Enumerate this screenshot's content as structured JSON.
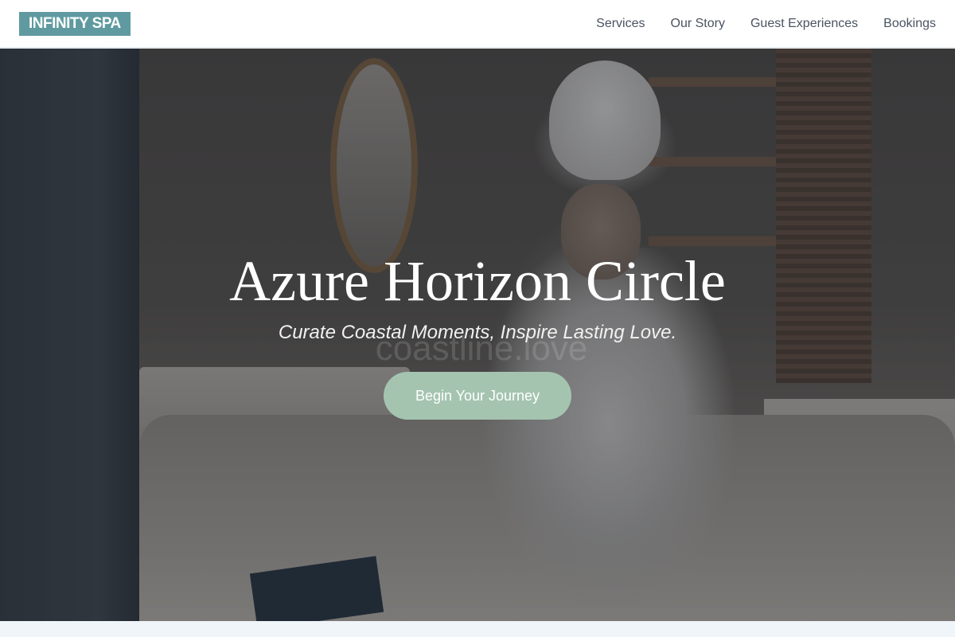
{
  "header": {
    "logo": "INFINITY SPA",
    "nav": [
      {
        "label": "Services"
      },
      {
        "label": "Our Story"
      },
      {
        "label": "Guest Experiences"
      },
      {
        "label": "Bookings"
      }
    ]
  },
  "hero": {
    "title": "Azure Horizon Circle",
    "subtitle": "Curate Coastal Moments, Inspire Lasting Love.",
    "cta_label": "Begin Your Journey",
    "watermark": "coastline.love"
  },
  "colors": {
    "logo_bg": "#5f9aa0",
    "cta_bg": "#a4c4b0",
    "nav_text": "#4a5360",
    "page_bg": "#f0f5fa"
  }
}
